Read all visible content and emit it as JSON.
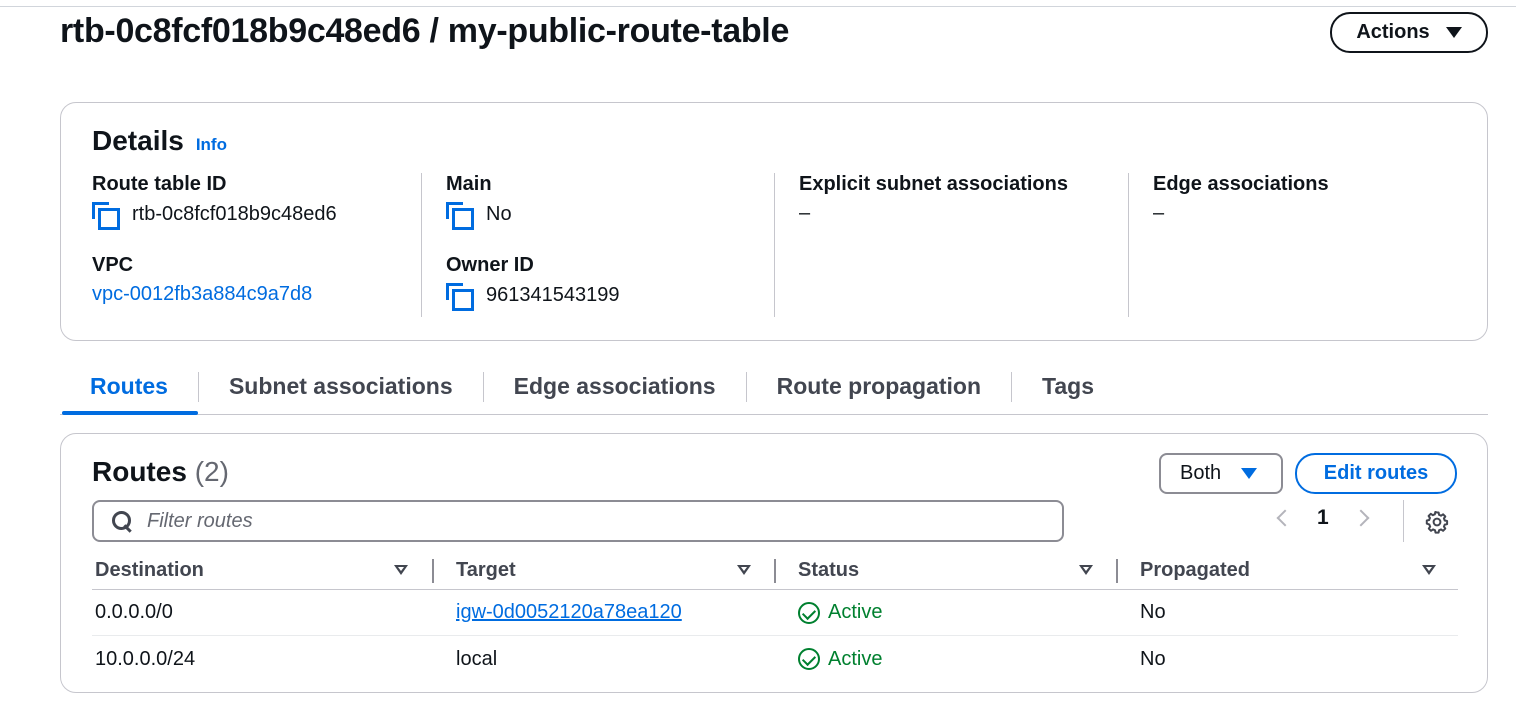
{
  "page": {
    "title": "rtb-0c8fcf018b9c48ed6 / my-public-route-table",
    "actions_label": "Actions"
  },
  "details": {
    "heading": "Details",
    "info_label": "Info",
    "fields": {
      "route_table_id": {
        "label": "Route table ID",
        "value": "rtb-0c8fcf018b9c48ed6"
      },
      "vpc": {
        "label": "VPC",
        "value": "vpc-0012fb3a884c9a7d8"
      },
      "main": {
        "label": "Main",
        "value": "No"
      },
      "owner_id": {
        "label": "Owner ID",
        "value": "961341543199"
      },
      "explicit_subnet": {
        "label": "Explicit subnet associations",
        "value": "–"
      },
      "edge": {
        "label": "Edge associations",
        "value": "–"
      }
    }
  },
  "tabs": [
    {
      "label": "Routes",
      "active": true
    },
    {
      "label": "Subnet associations",
      "active": false
    },
    {
      "label": "Edge associations",
      "active": false
    },
    {
      "label": "Route propagation",
      "active": false
    },
    {
      "label": "Tags",
      "active": false
    }
  ],
  "routes": {
    "title": "Routes",
    "count": "(2)",
    "filter_select": "Both",
    "edit_label": "Edit routes",
    "search_placeholder": "Filter routes",
    "page": "1",
    "columns": [
      "Destination",
      "Target",
      "Status",
      "Propagated"
    ],
    "rows": [
      {
        "destination": "0.0.0.0/0",
        "target": "igw-0d0052120a78ea120",
        "target_is_link": true,
        "status": "Active",
        "propagated": "No"
      },
      {
        "destination": "10.0.0.0/24",
        "target": "local",
        "target_is_link": false,
        "status": "Active",
        "propagated": "No"
      }
    ]
  },
  "icons": {
    "copy": "copy-icon",
    "search": "search-icon",
    "settings": "gear-icon",
    "status_ok": "check-circle-icon",
    "sort": "sort-caret-icon"
  },
  "colors": {
    "accent": "#006ce0",
    "success": "#00802f",
    "text": "#0f141a",
    "border": "#c6c6cd"
  }
}
